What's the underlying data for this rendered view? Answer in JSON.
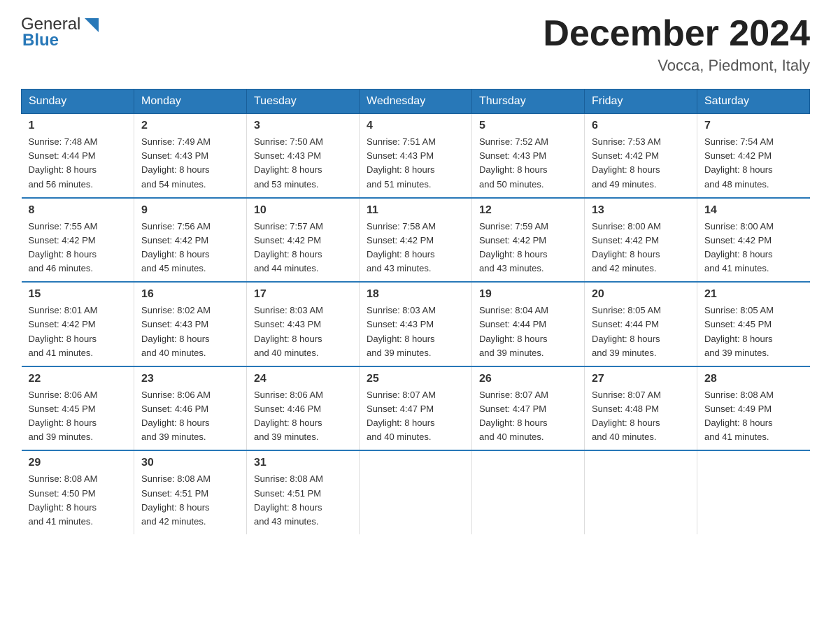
{
  "header": {
    "logo_general": "General",
    "logo_blue": "Blue",
    "title": "December 2024",
    "subtitle": "Vocca, Piedmont, Italy"
  },
  "days_of_week": [
    "Sunday",
    "Monday",
    "Tuesday",
    "Wednesday",
    "Thursday",
    "Friday",
    "Saturday"
  ],
  "weeks": [
    [
      {
        "day": "1",
        "info": "Sunrise: 7:48 AM\nSunset: 4:44 PM\nDaylight: 8 hours\nand 56 minutes."
      },
      {
        "day": "2",
        "info": "Sunrise: 7:49 AM\nSunset: 4:43 PM\nDaylight: 8 hours\nand 54 minutes."
      },
      {
        "day": "3",
        "info": "Sunrise: 7:50 AM\nSunset: 4:43 PM\nDaylight: 8 hours\nand 53 minutes."
      },
      {
        "day": "4",
        "info": "Sunrise: 7:51 AM\nSunset: 4:43 PM\nDaylight: 8 hours\nand 51 minutes."
      },
      {
        "day": "5",
        "info": "Sunrise: 7:52 AM\nSunset: 4:43 PM\nDaylight: 8 hours\nand 50 minutes."
      },
      {
        "day": "6",
        "info": "Sunrise: 7:53 AM\nSunset: 4:42 PM\nDaylight: 8 hours\nand 49 minutes."
      },
      {
        "day": "7",
        "info": "Sunrise: 7:54 AM\nSunset: 4:42 PM\nDaylight: 8 hours\nand 48 minutes."
      }
    ],
    [
      {
        "day": "8",
        "info": "Sunrise: 7:55 AM\nSunset: 4:42 PM\nDaylight: 8 hours\nand 46 minutes."
      },
      {
        "day": "9",
        "info": "Sunrise: 7:56 AM\nSunset: 4:42 PM\nDaylight: 8 hours\nand 45 minutes."
      },
      {
        "day": "10",
        "info": "Sunrise: 7:57 AM\nSunset: 4:42 PM\nDaylight: 8 hours\nand 44 minutes."
      },
      {
        "day": "11",
        "info": "Sunrise: 7:58 AM\nSunset: 4:42 PM\nDaylight: 8 hours\nand 43 minutes."
      },
      {
        "day": "12",
        "info": "Sunrise: 7:59 AM\nSunset: 4:42 PM\nDaylight: 8 hours\nand 43 minutes."
      },
      {
        "day": "13",
        "info": "Sunrise: 8:00 AM\nSunset: 4:42 PM\nDaylight: 8 hours\nand 42 minutes."
      },
      {
        "day": "14",
        "info": "Sunrise: 8:00 AM\nSunset: 4:42 PM\nDaylight: 8 hours\nand 41 minutes."
      }
    ],
    [
      {
        "day": "15",
        "info": "Sunrise: 8:01 AM\nSunset: 4:42 PM\nDaylight: 8 hours\nand 41 minutes."
      },
      {
        "day": "16",
        "info": "Sunrise: 8:02 AM\nSunset: 4:43 PM\nDaylight: 8 hours\nand 40 minutes."
      },
      {
        "day": "17",
        "info": "Sunrise: 8:03 AM\nSunset: 4:43 PM\nDaylight: 8 hours\nand 40 minutes."
      },
      {
        "day": "18",
        "info": "Sunrise: 8:03 AM\nSunset: 4:43 PM\nDaylight: 8 hours\nand 39 minutes."
      },
      {
        "day": "19",
        "info": "Sunrise: 8:04 AM\nSunset: 4:44 PM\nDaylight: 8 hours\nand 39 minutes."
      },
      {
        "day": "20",
        "info": "Sunrise: 8:05 AM\nSunset: 4:44 PM\nDaylight: 8 hours\nand 39 minutes."
      },
      {
        "day": "21",
        "info": "Sunrise: 8:05 AM\nSunset: 4:45 PM\nDaylight: 8 hours\nand 39 minutes."
      }
    ],
    [
      {
        "day": "22",
        "info": "Sunrise: 8:06 AM\nSunset: 4:45 PM\nDaylight: 8 hours\nand 39 minutes."
      },
      {
        "day": "23",
        "info": "Sunrise: 8:06 AM\nSunset: 4:46 PM\nDaylight: 8 hours\nand 39 minutes."
      },
      {
        "day": "24",
        "info": "Sunrise: 8:06 AM\nSunset: 4:46 PM\nDaylight: 8 hours\nand 39 minutes."
      },
      {
        "day": "25",
        "info": "Sunrise: 8:07 AM\nSunset: 4:47 PM\nDaylight: 8 hours\nand 40 minutes."
      },
      {
        "day": "26",
        "info": "Sunrise: 8:07 AM\nSunset: 4:47 PM\nDaylight: 8 hours\nand 40 minutes."
      },
      {
        "day": "27",
        "info": "Sunrise: 8:07 AM\nSunset: 4:48 PM\nDaylight: 8 hours\nand 40 minutes."
      },
      {
        "day": "28",
        "info": "Sunrise: 8:08 AM\nSunset: 4:49 PM\nDaylight: 8 hours\nand 41 minutes."
      }
    ],
    [
      {
        "day": "29",
        "info": "Sunrise: 8:08 AM\nSunset: 4:50 PM\nDaylight: 8 hours\nand 41 minutes."
      },
      {
        "day": "30",
        "info": "Sunrise: 8:08 AM\nSunset: 4:51 PM\nDaylight: 8 hours\nand 42 minutes."
      },
      {
        "day": "31",
        "info": "Sunrise: 8:08 AM\nSunset: 4:51 PM\nDaylight: 8 hours\nand 43 minutes."
      },
      {
        "day": "",
        "info": ""
      },
      {
        "day": "",
        "info": ""
      },
      {
        "day": "",
        "info": ""
      },
      {
        "day": "",
        "info": ""
      }
    ]
  ]
}
